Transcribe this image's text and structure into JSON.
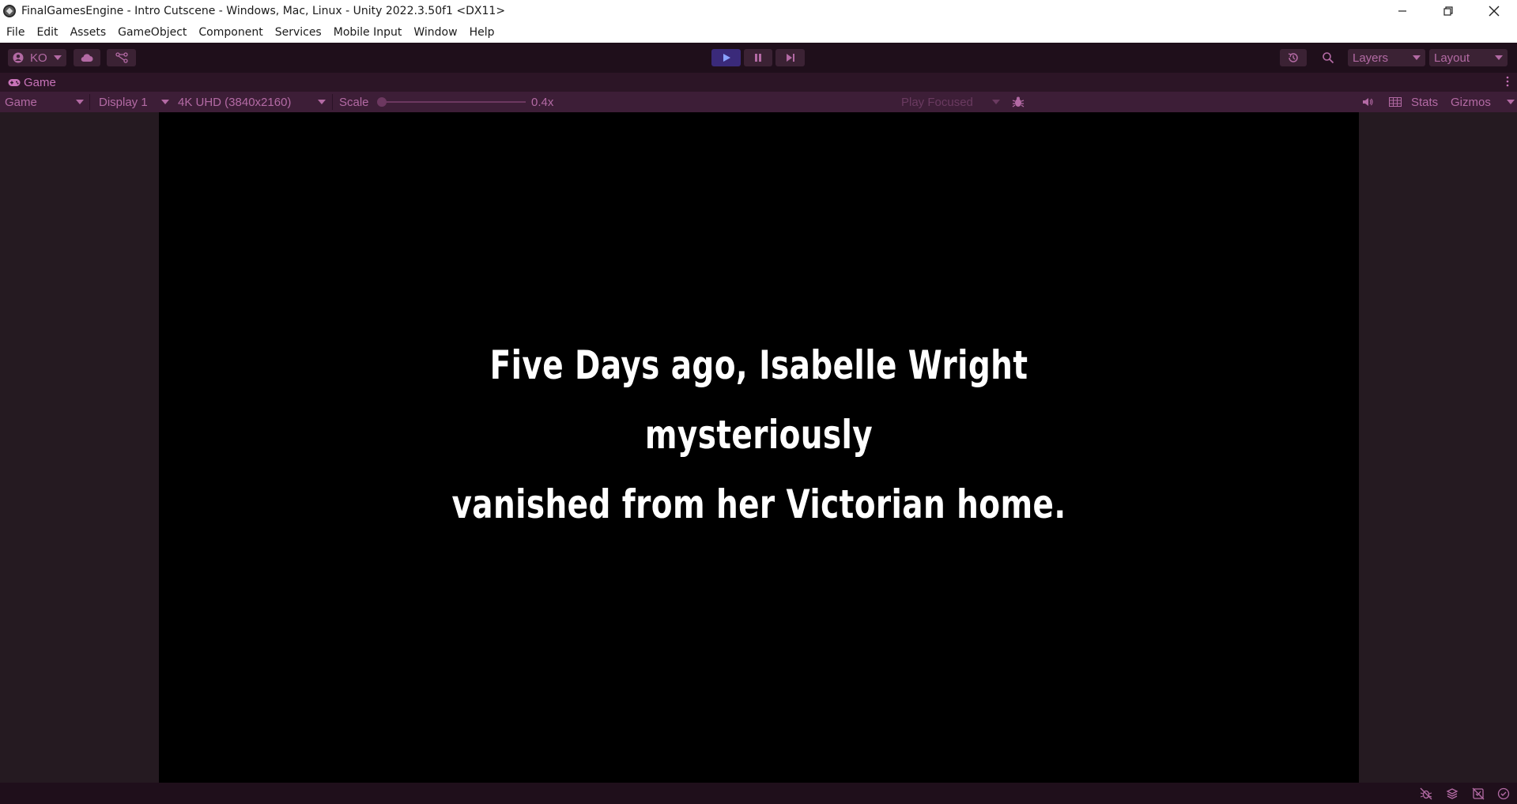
{
  "window": {
    "title": "FinalGamesEngine - Intro Cutscene - Windows, Mac, Linux - Unity 2022.3.50f1 <DX11>",
    "minimize": "—",
    "restore": "❐",
    "close": "✕"
  },
  "menu": {
    "items": [
      "File",
      "Edit",
      "Assets",
      "GameObject",
      "Component",
      "Services",
      "Mobile Input",
      "Window",
      "Help"
    ]
  },
  "toolbar": {
    "account_label": "KO",
    "layers_label": "Layers",
    "layout_label": "Layout"
  },
  "tab": {
    "label": "Game"
  },
  "gamebar": {
    "view_mode": "Game",
    "display": "Display 1",
    "resolution": "4K UHD (3840x2160)",
    "scale_label": "Scale",
    "scale_value": "0.4x",
    "scale_fraction": 0.0,
    "play_mode": "Play Focused",
    "stats_label": "Stats",
    "gizmos_label": "Gizmos"
  },
  "game": {
    "line1": "Five Days ago, Isabelle Wright mysteriously",
    "line2": "vanished from her Victorian home."
  },
  "colors": {
    "accent": "#b36aa4",
    "toolbar_bg": "#1f0f1b",
    "gamebar_bg": "#3d1e37",
    "play_active": "#3a2a7a"
  },
  "icons": {
    "account": "account-icon",
    "cloud": "cloud-icon",
    "collab": "collab-icon",
    "play": "play-icon",
    "pause": "pause-icon",
    "step": "step-icon",
    "history": "history-icon",
    "search": "search-icon",
    "bug": "bug-icon",
    "audio": "audio-icon",
    "grid": "grid-icon"
  }
}
